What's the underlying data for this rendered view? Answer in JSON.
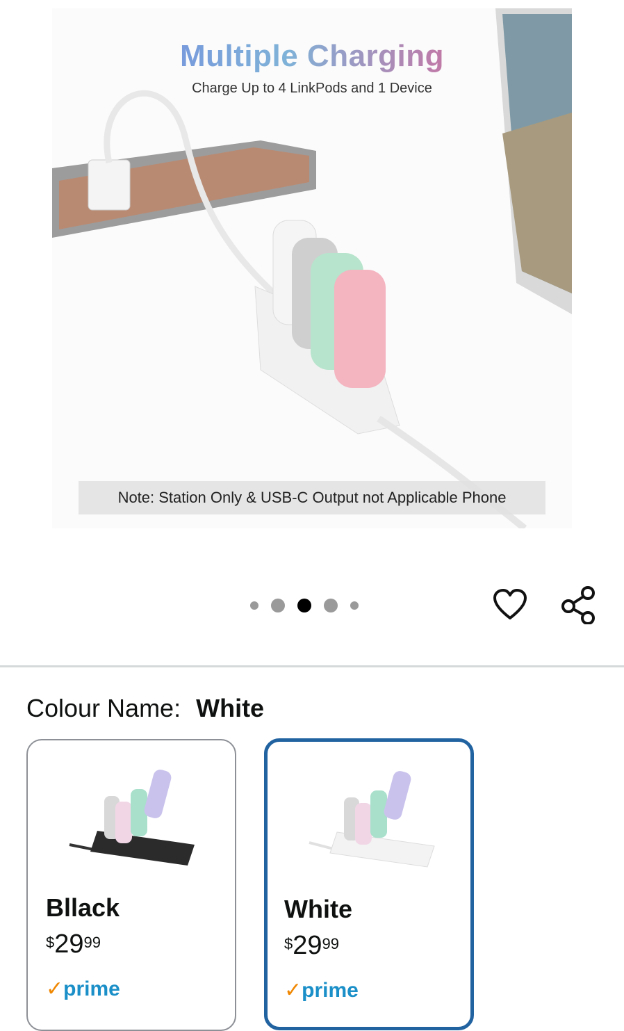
{
  "hero": {
    "title": "Multiple Charging",
    "subtitle": "Charge Up to 4 LinkPods and 1 Device",
    "note": "Note: Station Only & USB-C Output not Applicable Phone",
    "colors": {
      "title_start": "#6f7fe0",
      "title_end": "#e06a84"
    }
  },
  "carousel": {
    "total_images": 5,
    "active_index": 2
  },
  "actions": {
    "wishlist_icon": "heart-outline-icon",
    "share_icon": "share-icon"
  },
  "colour": {
    "label": "Colour Name:",
    "selected": "White",
    "options": [
      {
        "name": "Bllack",
        "currency": "$",
        "price_whole": "29",
        "price_fraction": "99",
        "prime": "prime",
        "selected": false
      },
      {
        "name": "White",
        "currency": "$",
        "price_whole": "29",
        "price_fraction": "99",
        "prime": "prime",
        "selected": true
      }
    ]
  },
  "accent": {
    "selected_border": "#2162a1",
    "prime_blue": "#1a8fc8",
    "prime_check": "#f08804"
  }
}
